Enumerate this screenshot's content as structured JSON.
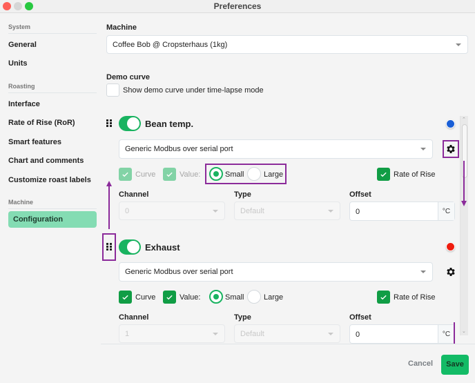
{
  "window": {
    "title": "Preferences"
  },
  "sidebar": {
    "sections": [
      {
        "label": "System",
        "items": [
          {
            "label": "General"
          },
          {
            "label": "Units"
          }
        ]
      },
      {
        "label": "Roasting",
        "items": [
          {
            "label": "Interface"
          },
          {
            "label": "Rate of Rise (RoR)"
          },
          {
            "label": "Smart features"
          },
          {
            "label": "Chart and comments"
          },
          {
            "label": "Customize roast labels"
          }
        ]
      },
      {
        "label": "Machine",
        "items": [
          {
            "label": "Configuration",
            "active": true
          }
        ]
      }
    ]
  },
  "main": {
    "machine": {
      "label": "Machine",
      "selected": "Coffee Bob @ Cropsterhaus (1kg)"
    },
    "demo_curve": {
      "label": "Demo curve",
      "checkbox_label": "Show demo curve under time-lapse mode",
      "checked": false
    },
    "sensors": [
      {
        "name": "Bean temp.",
        "enabled": true,
        "color": "#1a5fd6",
        "source": "Generic Modbus over serial port",
        "curve": {
          "label": "Curve",
          "checked": true,
          "disabled": true
        },
        "value": {
          "label": "Value:",
          "checked": true,
          "disabled": true
        },
        "size_options": [
          {
            "label": "Small",
            "selected": true
          },
          {
            "label": "Large",
            "selected": false
          }
        ],
        "rate_of_rise": {
          "label": "Rate of Rise",
          "checked": true
        },
        "channel": {
          "label": "Channel",
          "value": "0",
          "disabled": true
        },
        "type": {
          "label": "Type",
          "value": "Default",
          "disabled": true
        },
        "offset": {
          "label": "Offset",
          "value": "0",
          "unit": "°C"
        }
      },
      {
        "name": "Exhaust",
        "enabled": true,
        "color": "#ee1c0e",
        "source": "Generic Modbus over serial port",
        "curve": {
          "label": "Curve",
          "checked": true,
          "disabled": false
        },
        "value": {
          "label": "Value:",
          "checked": true,
          "disabled": false
        },
        "size_options": [
          {
            "label": "Small",
            "selected": true
          },
          {
            "label": "Large",
            "selected": false
          }
        ],
        "rate_of_rise": {
          "label": "Rate of Rise",
          "checked": true
        },
        "channel": {
          "label": "Channel",
          "value": "1",
          "disabled": true
        },
        "type": {
          "label": "Type",
          "value": "Default",
          "disabled": true
        },
        "offset": {
          "label": "Offset",
          "value": "0",
          "unit": "°C"
        }
      }
    ]
  },
  "footer": {
    "cancel_label": "Cancel",
    "save_label": "Save"
  },
  "colors": {
    "accent_green": "#13bb66",
    "active_sidebar": "#84dcb3",
    "annotation_purple": "#8b2a9a"
  }
}
